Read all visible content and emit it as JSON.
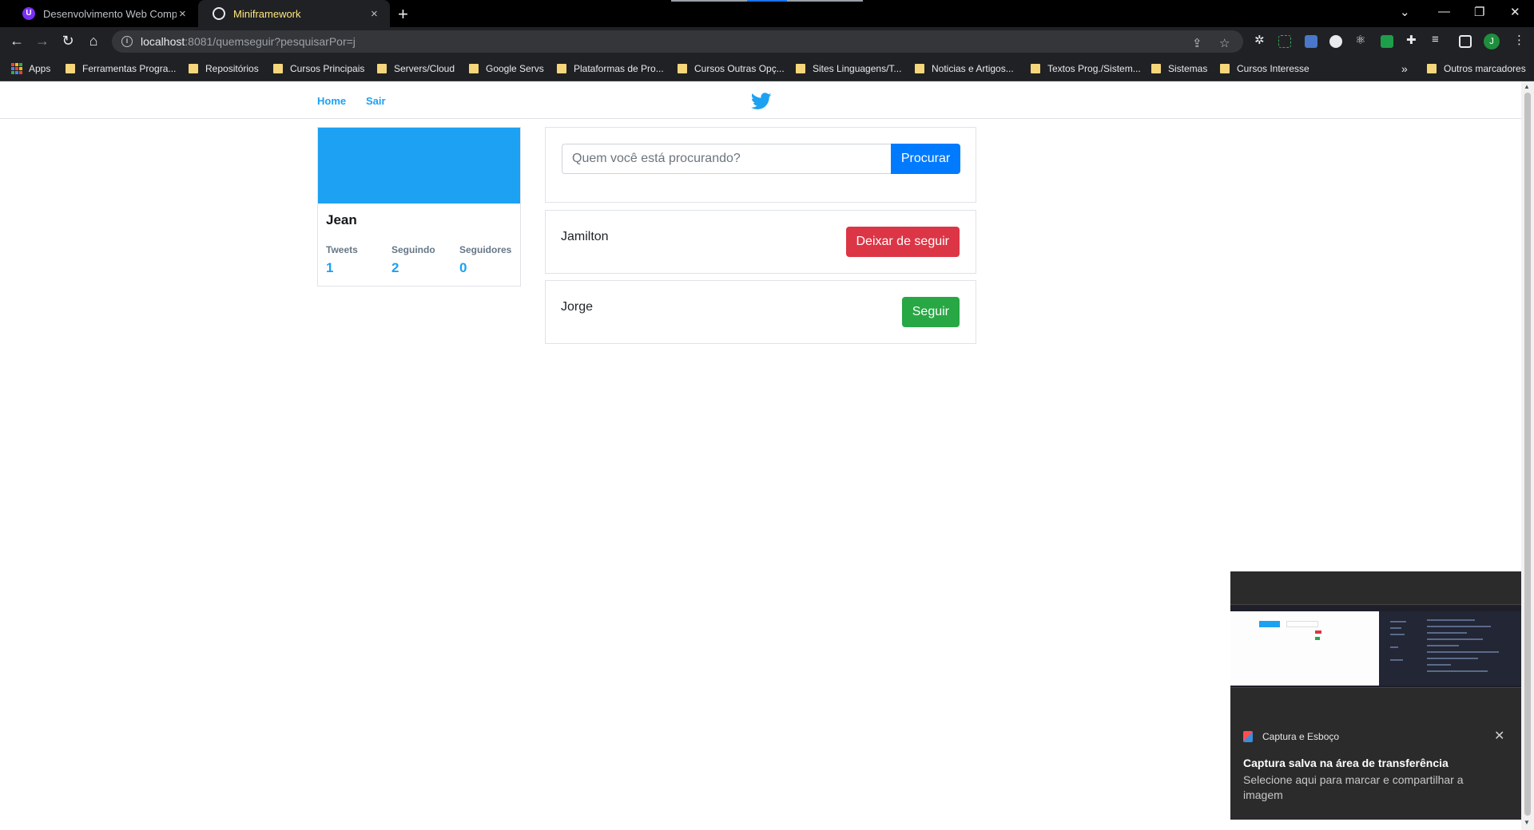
{
  "browser": {
    "tabs": [
      {
        "title": "Desenvolvimento Web Completo",
        "active": false,
        "icon": "udemy-icon"
      },
      {
        "title": "Miniframework",
        "active": true,
        "icon": "globe-icon"
      }
    ],
    "address": {
      "host": "localhost",
      "path": ":8081/quemseguir?pesquisarPor=j"
    },
    "profile_initial": "J",
    "bookmarks": [
      {
        "label": "Apps"
      },
      {
        "label": "Ferramentas Progra..."
      },
      {
        "label": "Repositórios"
      },
      {
        "label": "Cursos Principais"
      },
      {
        "label": "Servers/Cloud"
      },
      {
        "label": "Google Servs"
      },
      {
        "label": "Plataformas de Pro..."
      },
      {
        "label": "Cursos Outras Opç..."
      },
      {
        "label": "Sites Linguagens/T..."
      },
      {
        "label": "Noticias e Artigos..."
      },
      {
        "label": "Textos Prog./Sistem..."
      },
      {
        "label": "Sistemas"
      },
      {
        "label": "Cursos Interesse"
      }
    ],
    "bookmarks_overflow": "»",
    "other_bookmarks": "Outros marcadores"
  },
  "nav": {
    "home": "Home",
    "logout": "Sair"
  },
  "profile": {
    "name": "Jean",
    "stats": [
      {
        "label": "Tweets",
        "value": "1"
      },
      {
        "label": "Seguindo",
        "value": "2"
      },
      {
        "label": "Seguidores",
        "value": "0"
      }
    ]
  },
  "search": {
    "placeholder": "Quem você está procurando?",
    "button": "Procurar"
  },
  "users": [
    {
      "name": "Jamilton",
      "action": "Deixar de seguir"
    },
    {
      "name": "Jorge",
      "action": "Seguir"
    }
  ],
  "toast": {
    "app": "Captura e Esboço",
    "title": "Captura salva na área de transferência",
    "body": "Selecione aqui para marcar e compartilhar a imagem"
  },
  "colors": {
    "twitter_blue": "#1da1f2",
    "primary": "#007bff",
    "danger": "#dc3545",
    "success": "#28a745"
  }
}
